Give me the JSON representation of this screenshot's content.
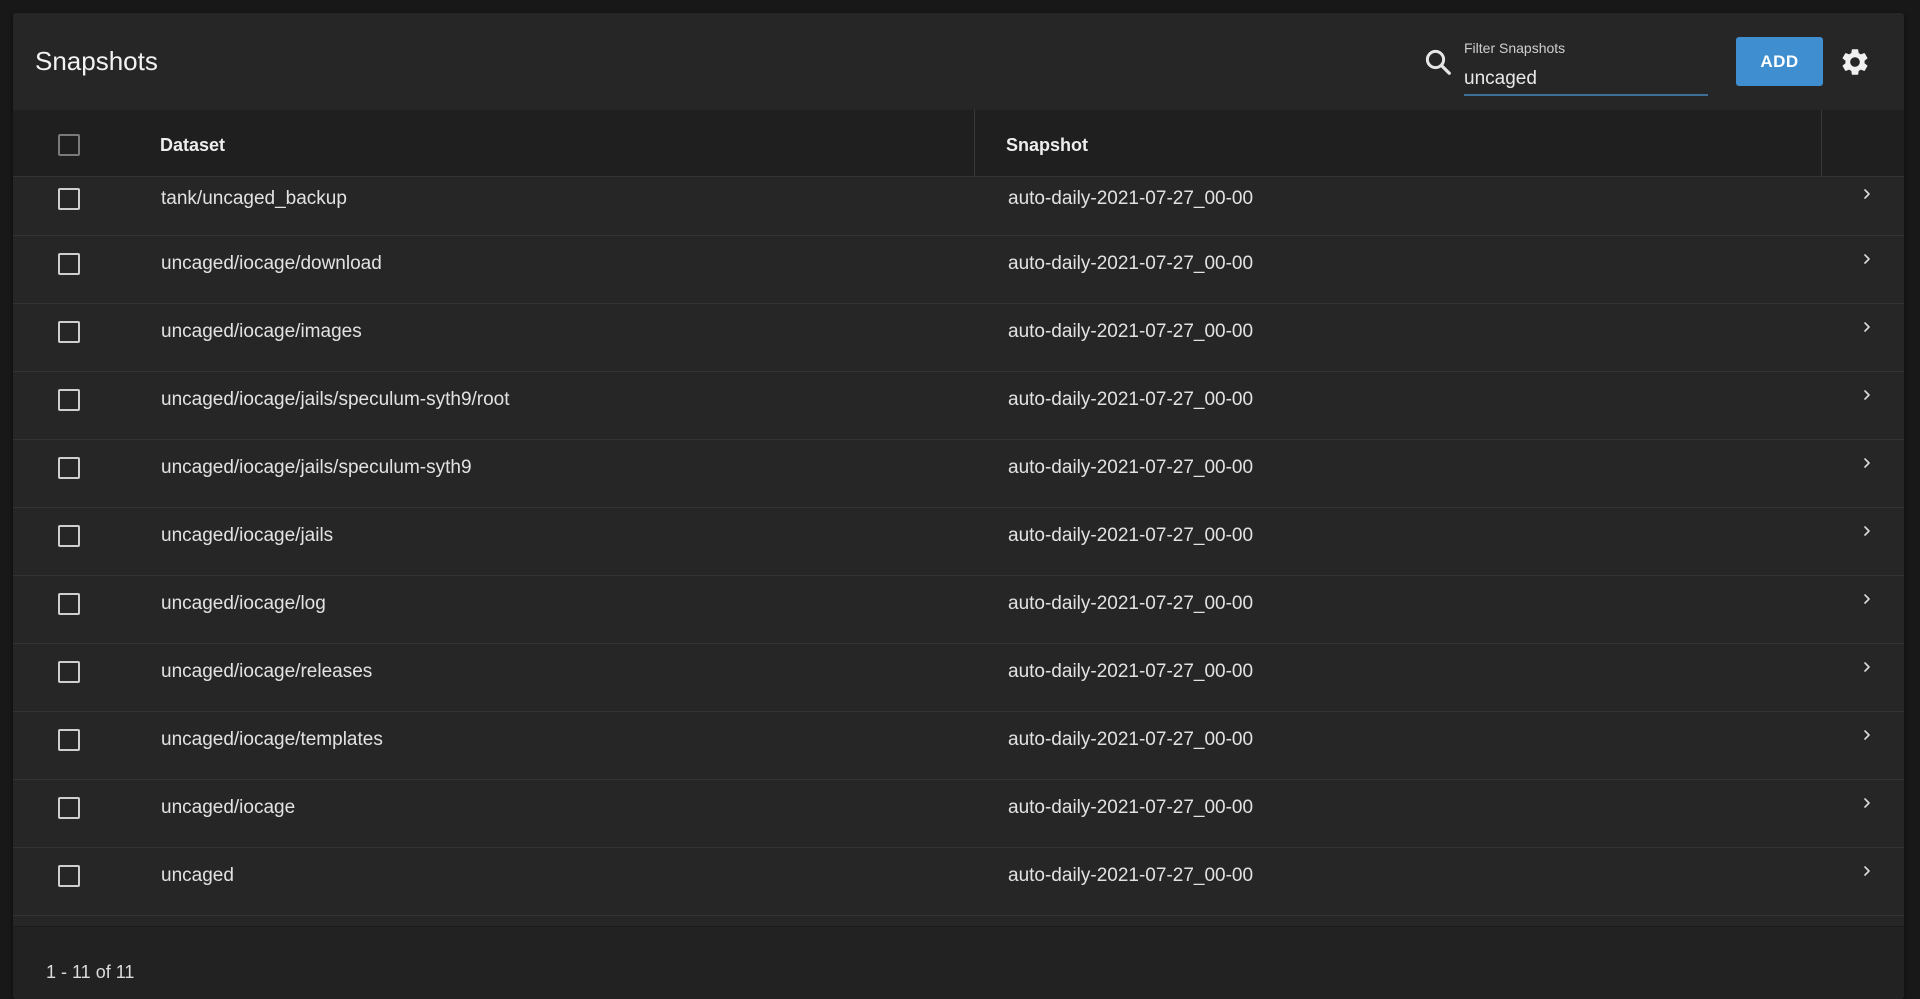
{
  "header": {
    "title": "Snapshots",
    "filter_label": "Filter Snapshots",
    "filter_value": "uncaged",
    "add_label": "ADD"
  },
  "table": {
    "columns": [
      "Dataset",
      "Snapshot"
    ],
    "rows": [
      {
        "dataset": "tank/uncaged_backup",
        "snapshot": "auto-daily-2021-07-27_00-00"
      },
      {
        "dataset": "uncaged/iocage/download",
        "snapshot": "auto-daily-2021-07-27_00-00"
      },
      {
        "dataset": "uncaged/iocage/images",
        "snapshot": "auto-daily-2021-07-27_00-00"
      },
      {
        "dataset": "uncaged/iocage/jails/speculum-syth9/root",
        "snapshot": "auto-daily-2021-07-27_00-00"
      },
      {
        "dataset": "uncaged/iocage/jails/speculum-syth9",
        "snapshot": "auto-daily-2021-07-27_00-00"
      },
      {
        "dataset": "uncaged/iocage/jails",
        "snapshot": "auto-daily-2021-07-27_00-00"
      },
      {
        "dataset": "uncaged/iocage/log",
        "snapshot": "auto-daily-2021-07-27_00-00"
      },
      {
        "dataset": "uncaged/iocage/releases",
        "snapshot": "auto-daily-2021-07-27_00-00"
      },
      {
        "dataset": "uncaged/iocage/templates",
        "snapshot": "auto-daily-2021-07-27_00-00"
      },
      {
        "dataset": "uncaged/iocage",
        "snapshot": "auto-daily-2021-07-27_00-00"
      },
      {
        "dataset": "uncaged",
        "snapshot": "auto-daily-2021-07-27_00-00"
      }
    ]
  },
  "footer": {
    "paginator": "1 - 11 of 11"
  },
  "icons": {
    "search": "search-icon",
    "settings": "gear-icon",
    "row_expand": "chevron-right-icon"
  },
  "colors": {
    "accent": "#3f8fd0",
    "background": "#262626"
  }
}
